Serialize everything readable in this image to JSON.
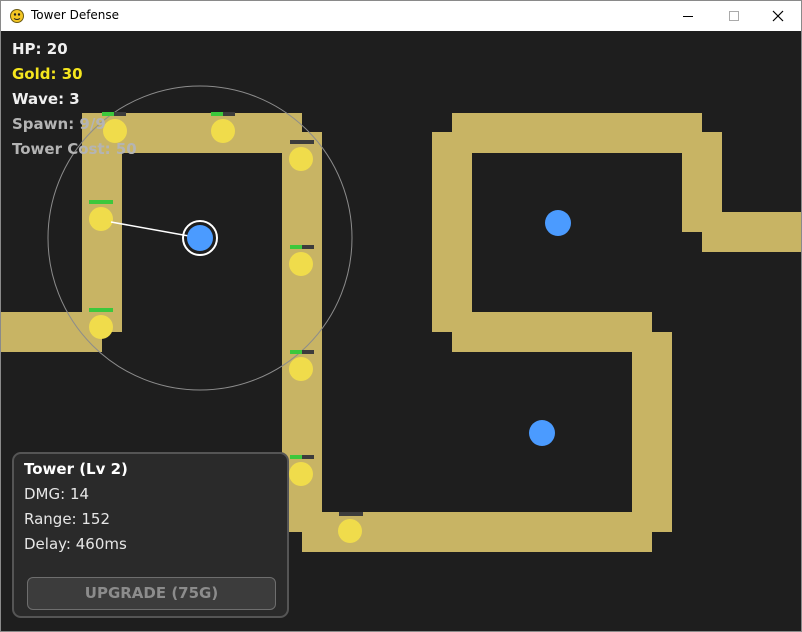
{
  "window": {
    "title": "Tower Defense",
    "icon": "pygame-snake-icon"
  },
  "hud": {
    "hp": "HP: 20",
    "gold": "Gold: 30",
    "wave": "Wave: 3",
    "spawn": "Spawn: 9/9",
    "tower_cost": "Tower Cost: 50"
  },
  "tower_panel": {
    "title": "Tower (Lv 2)",
    "dmg": "DMG: 14",
    "range": "Range: 152",
    "delay": "Delay: 460ms",
    "upgrade_label": "UPGRADE (75G)",
    "upgrade_enabled": false
  },
  "colors": {
    "background": "#1e1e1e",
    "path": "#c8b464",
    "tower": "#4b9bff",
    "enemy": "#f0dc4b",
    "health_good": "#3cc83c",
    "gold_text": "#f5e61e"
  },
  "game": {
    "towers": 3,
    "selected_tower_level": 2,
    "enemy_health": [
      0.5,
      0.5,
      0.75,
      1.0,
      1.0,
      0.25,
      0.5,
      0.5,
      0.0
    ]
  }
}
